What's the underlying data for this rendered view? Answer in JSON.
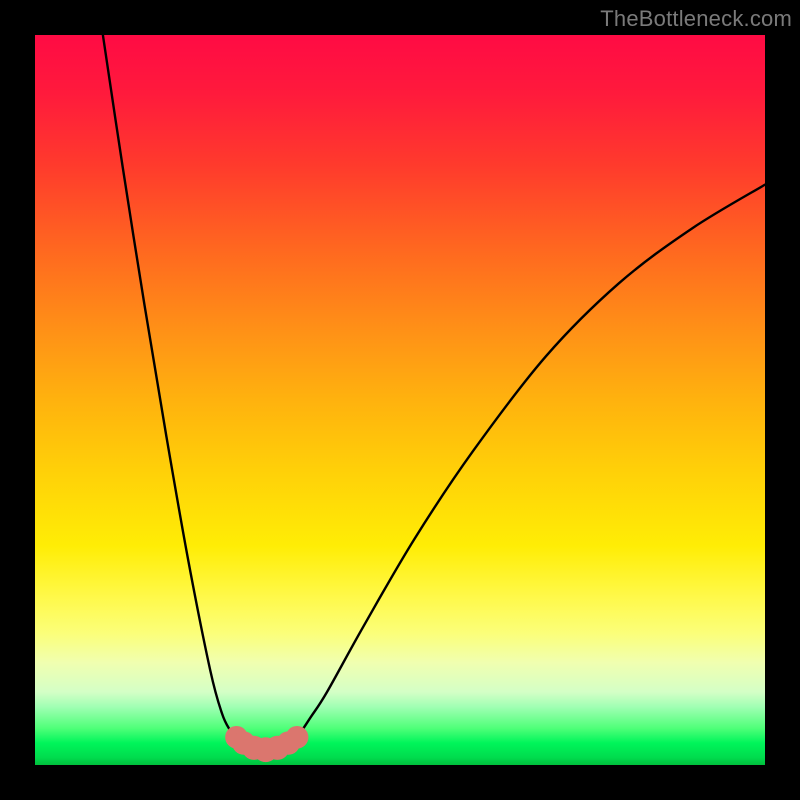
{
  "watermark": "TheBottleneck.com",
  "colors": {
    "frame": "#000000",
    "curve_stroke": "#000000",
    "bead_fill": "#db766e",
    "watermark_text": "#7a7a7a"
  },
  "chart_data": {
    "type": "line",
    "title": "",
    "xlabel": "",
    "ylabel": "",
    "xlim": [
      0,
      100
    ],
    "ylim": [
      0,
      100
    ],
    "grid": false,
    "legend": false,
    "note": "Bottleneck-style V-curve; axes are percent-of-plot coordinates with origin at bottom-left. Values estimated from pixels.",
    "series": [
      {
        "name": "left-branch",
        "x": [
          9.3,
          12,
          15,
          18,
          21,
          24,
          25.6,
          26.7,
          27.6
        ],
        "y": [
          100,
          82,
          63,
          45,
          28,
          13,
          7.1,
          4.8,
          3.8
        ]
      },
      {
        "name": "bottom-segment",
        "x": [
          27.6,
          29.0,
          30.5,
          32.2,
          33.8,
          34.8,
          35.9
        ],
        "y": [
          3.8,
          2.9,
          2.3,
          2.1,
          2.3,
          2.9,
          3.8
        ]
      },
      {
        "name": "right-branch",
        "x": [
          35.9,
          37.8,
          40,
          45,
          52,
          60,
          70,
          80,
          90,
          100
        ],
        "y": [
          3.8,
          6.6,
          10,
          19,
          31,
          43,
          56,
          66,
          73.5,
          79.5
        ]
      }
    ],
    "beads": [
      {
        "x": 27.6,
        "y": 3.8,
        "r": 1.55
      },
      {
        "x": 28.6,
        "y": 3.0,
        "r": 1.6
      },
      {
        "x": 30.0,
        "y": 2.35,
        "r": 1.65
      },
      {
        "x": 31.6,
        "y": 2.1,
        "r": 1.7
      },
      {
        "x": 33.2,
        "y": 2.35,
        "r": 1.65
      },
      {
        "x": 34.7,
        "y": 3.0,
        "r": 1.6
      },
      {
        "x": 35.9,
        "y": 3.8,
        "r": 1.55
      }
    ]
  }
}
